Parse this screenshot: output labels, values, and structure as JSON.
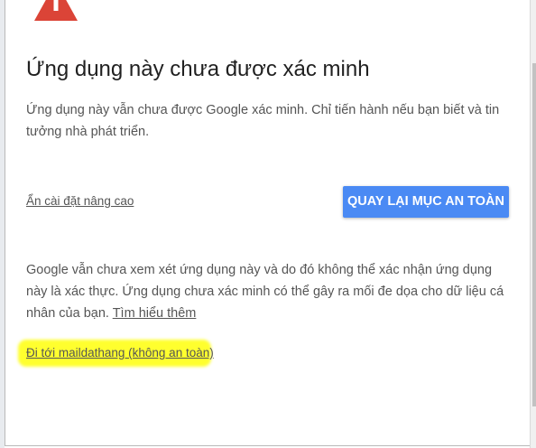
{
  "header": {
    "warning_icon": "warning-triangle-icon",
    "title": "Ứng dụng này chưa được xác minh"
  },
  "main": {
    "description": "Ứng dụng này vẫn chưa được Google xác minh. Chỉ tiến hành nếu bạn biết và tin tưởng nhà phát triển.",
    "advanced_link": "Ẩn cài đặt nâng cao",
    "back_button": "QUAY LẠI MỤC AN TOÀN"
  },
  "details": {
    "text": "Google vẫn chưa xem xét ứng dụng này và do đó không thể xác nhận ứng dụng này là xác thực. Ứng dụng chưa xác minh có thể gây ra mối đe dọa cho dữ liệu cá nhân của bạn.",
    "learn_more_link": "Tìm hiểu thêm",
    "proceed_link": "Đi tới maildathang (không an toàn)"
  },
  "colors": {
    "warning_red": "#db4437",
    "button_blue": "#4a8af4",
    "highlight_yellow": "#ffff2e",
    "text_dark": "#212121",
    "text_body": "#555555"
  }
}
